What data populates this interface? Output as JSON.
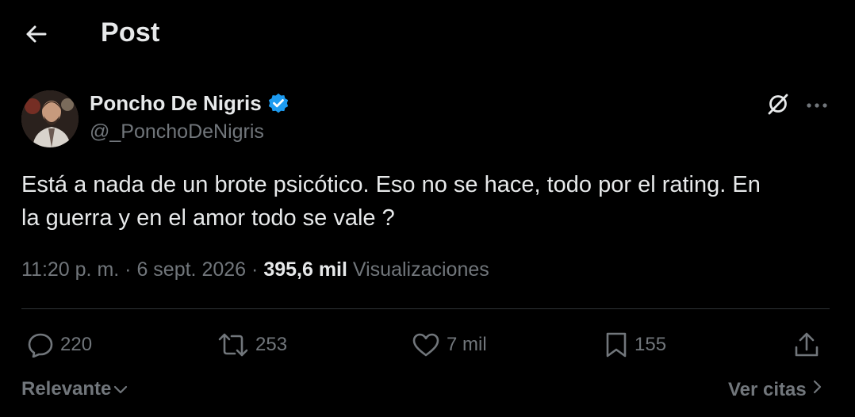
{
  "header": {
    "title": "Post",
    "back_icon": "arrow-left-icon"
  },
  "author": {
    "name": "Poncho De Nigris",
    "handle": "@_PonchoDeNigris",
    "verified": true,
    "verified_color": "#1d9bf0"
  },
  "tweet": {
    "text": "Está a nada de un brote psicótico. Eso no se hace, todo por el rating. En\nla guerra y en el amor todo se vale ?",
    "time": "11:20 p. m.",
    "separator": "·",
    "date": "6 sept. 2026",
    "views_count": "395,6 mil",
    "views_label": "Visualizaciones"
  },
  "actions": {
    "replies": "220",
    "reposts": "253",
    "likes": "7 mil",
    "bookmarks": "155",
    "icons": [
      "reply-icon",
      "repost-icon",
      "like-icon",
      "bookmark-icon",
      "share-icon"
    ]
  },
  "footer": {
    "sort_label": "Relevante",
    "quotes_label": "Ver citas"
  },
  "colors": {
    "background": "#000000",
    "text_primary": "#e7e9ea",
    "text_secondary": "#71767b",
    "divider": "#2f3336"
  }
}
